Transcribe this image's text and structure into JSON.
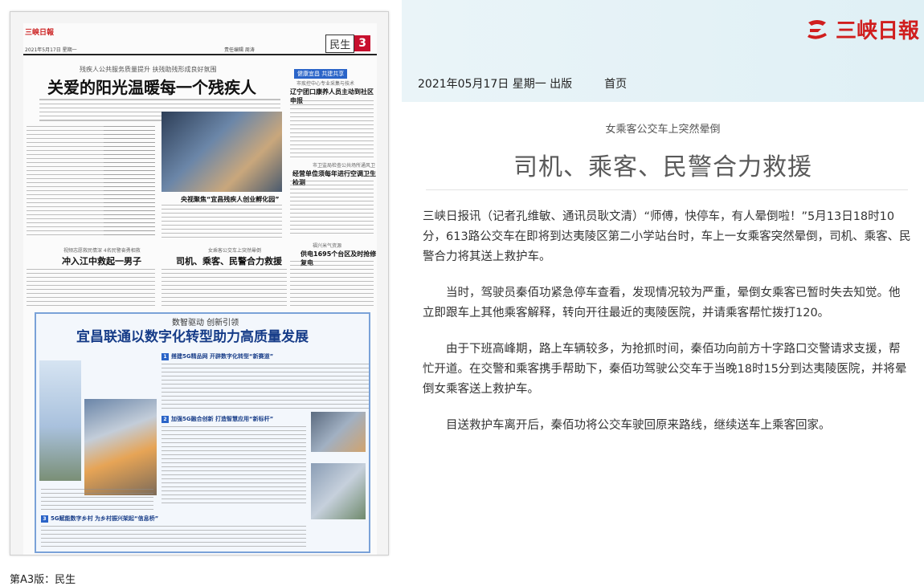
{
  "newspaper_page": {
    "logo": "三峡日報",
    "date_line": "2021年5月17日 星期一",
    "editor_line": "责任编辑 周涛",
    "section_name": "民生",
    "section_number": "3",
    "main_kicker": "残疾人公共服务质量提升  扶残助残形成良好氛围",
    "main_headline": "关爱的阳光温暖每一个残疾人",
    "side_box_label": "健康宜昌 共建共享",
    "side_kicker": "市疾控中心专业采集与技术",
    "side_headline": "辽宁团口康养人员主动到社区申报",
    "photo_headline": "央视聚焦“宜昌残疾人创业孵化园”",
    "story1_kicker": "视频志愿救民情深 4名民警奋勇相救",
    "story1_headline": "冲入江中救起一男子",
    "story2_kicker": "女乘客公交车上突然晕倒",
    "story2_headline": "司机、乘客、民警合力救援",
    "story3_kicker": "福兴米气资源",
    "story3_headline": "供电1695个台区及时抢修复电",
    "story4_kicker": "市卫监局检查公共场所通风卫生",
    "story4_headline": "经营单位须每年进行空调卫生检测",
    "feature_kicker": "数智驱动  创新引领",
    "feature_headline": "宜昌联通以数字化转型助力高质量发展",
    "sub1": "搭建5G精品网  开辟数字化转型“新赛道”",
    "sub2": "加强5G融合创新  打造智慧应用“新标杆”",
    "sub3": "5G赋能数字乡村  为乡村振兴架起“信息桥”"
  },
  "page_section_label": "第A3版：民生",
  "site": {
    "brand": "三峡日報"
  },
  "nav": {
    "date_edition": "2021年05月17日  星期一  出版",
    "home": "首页"
  },
  "article": {
    "kicker": "女乘客公交车上突然晕倒",
    "title": "司机、乘客、民警合力救援",
    "paragraphs": [
      "三峡日报讯（记者孔维敏、通讯员耿文清）“师傅，快停车，有人晕倒啦！”5月13日18时10分，613路公交车在即将到达夷陵区第二小学站台时，车上一女乘客突然晕倒，司机、乘客、民警合力将其送上救护车。",
      "当时，驾驶员秦佰功紧急停车查看，发现情况较为严重，晕倒女乘客已暂时失去知觉。他立即跟车上其他乘客解释，转向开往最近的夷陵医院，并请乘客帮忙拨打120。",
      "由于下班高峰期，路上车辆较多，为抢抓时间，秦佰功向前方十字路口交警请求支援，帮忙开道。在交警和乘客携手帮助下，秦佰功驾驶公交车于当晚18时15分到达夷陵医院，并将晕倒女乘客送上救护车。",
      "目送救护车离开后，秦佰功将公交车驶回原来路线，继续送车上乘客回家。"
    ]
  },
  "colors": {
    "brand_red": "#d01e1e",
    "header_bg": "#e5f2f7",
    "feature_blue": "#163c88"
  }
}
